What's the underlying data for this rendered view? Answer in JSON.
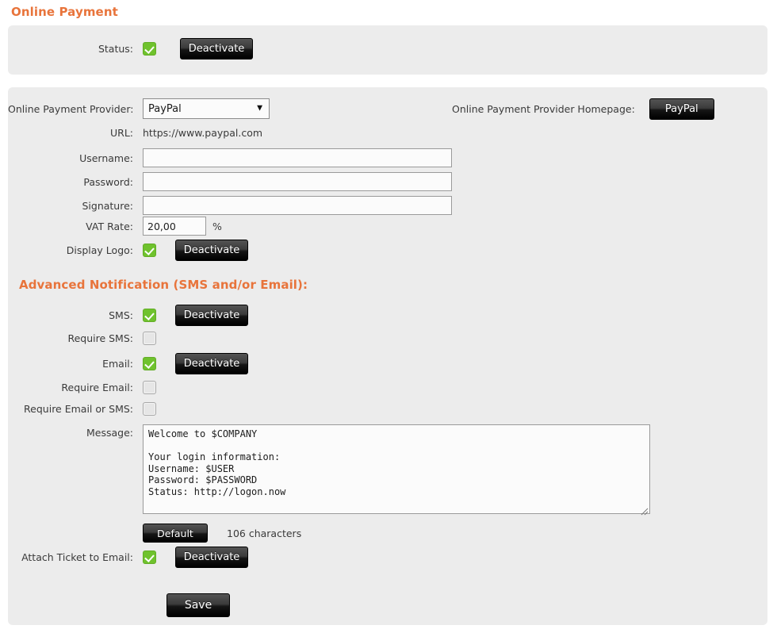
{
  "page_title": "Online Payment",
  "colors": {
    "heading_orange": "#e8743b",
    "panel_bg": "#ececec",
    "checkbox_green": "#6fc22d",
    "button_dark": "#000000"
  },
  "status_panel": {
    "status_label": "Status:",
    "status_checked": true,
    "deactivate_label": "Deactivate"
  },
  "provider": {
    "label": "Online Payment Provider:",
    "selected": "PayPal",
    "options": [
      "PayPal"
    ],
    "caret_icon": "chevron-down-icon",
    "homepage_label": "Online Payment Provider Homepage:",
    "homepage_button": "PayPal",
    "url_label": "URL:",
    "url_value": "https://www.paypal.com",
    "username_label": "Username:",
    "username_value": "",
    "username_placeholder": "",
    "password_label": "Password:",
    "password_value": "",
    "password_placeholder": "",
    "signature_label": "Signature:",
    "signature_value": "",
    "signature_placeholder": "",
    "vat_label": "VAT Rate:",
    "vat_value": "20,00",
    "vat_unit": "%",
    "display_logo_label": "Display Logo:",
    "display_logo_checked": true,
    "display_logo_button": "Deactivate"
  },
  "advanced": {
    "heading": "Advanced Notification (SMS and/or Email):",
    "sms_label": "SMS:",
    "sms_checked": true,
    "sms_button": "Deactivate",
    "require_sms_label": "Require SMS:",
    "require_sms_checked": false,
    "email_label": "Email:",
    "email_checked": true,
    "email_button": "Deactivate",
    "require_email_label": "Require Email:",
    "require_email_checked": false,
    "require_email_or_sms_label": "Require Email or SMS:",
    "require_email_or_sms_checked": false,
    "message_label": "Message:",
    "message_value": "Welcome to $COMPANY\n\nYour login information:\nUsername: $USER\nPassword: $PASSWORD\nStatus: http://logon.now",
    "default_button": "Default",
    "char_count": "106 characters",
    "attach_ticket_label": "Attach Ticket to Email:",
    "attach_ticket_checked": true,
    "attach_ticket_button": "Deactivate"
  },
  "footer": {
    "save_label": "Save"
  }
}
